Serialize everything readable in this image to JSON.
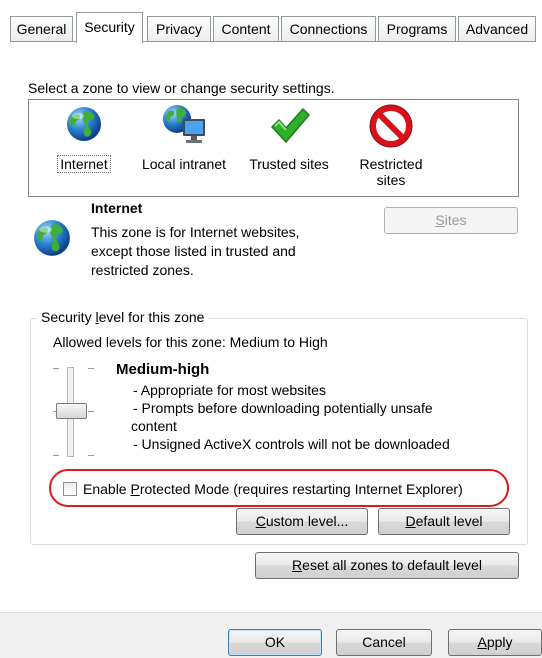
{
  "tabs": [
    {
      "label": "General",
      "active": false
    },
    {
      "label": "Security",
      "active": true
    },
    {
      "label": "Privacy",
      "active": false
    },
    {
      "label": "Content",
      "active": false
    },
    {
      "label": "Connections",
      "active": false
    },
    {
      "label": "Programs",
      "active": false
    },
    {
      "label": "Advanced",
      "active": false
    }
  ],
  "zone_prompt": "Select a zone to view or change security settings.",
  "zones": [
    {
      "label": "Internet",
      "icon": "globe-icon",
      "selected": true
    },
    {
      "label": "Local intranet",
      "icon": "intranet-icon",
      "selected": false
    },
    {
      "label": "Trusted sites",
      "icon": "checkmark-icon",
      "selected": false
    },
    {
      "label": "Restricted sites",
      "label_line1": "Restricted",
      "label_line2": "sites",
      "icon": "no-entry-icon",
      "selected": false
    }
  ],
  "zone_info": {
    "title": "Internet",
    "line1": "This zone is for Internet websites,",
    "line2": "except those listed in trusted and",
    "line3": "restricted zones.",
    "sites_button": {
      "accel": "S",
      "rest": "ites",
      "enabled": false
    }
  },
  "security_level": {
    "legend_pre": "Security ",
    "legend_accel": "l",
    "legend_post": "evel for this zone",
    "allowed": "Allowed levels for this zone: Medium to High",
    "level_name": "Medium-high",
    "bullets": [
      "- Appropriate for most websites",
      "- Prompts before downloading potentially unsafe",
      "content",
      "- Unsigned ActiveX controls will not be downloaded"
    ],
    "protected_mode": {
      "pre": "Enable ",
      "accel": "P",
      "post": "rotected Mode (requires restarting Internet Explorer)",
      "checked": false
    },
    "custom_button": {
      "accel": "C",
      "rest": "ustom level..."
    },
    "default_button": {
      "accel": "D",
      "rest": "efault level"
    }
  },
  "reset_button": {
    "accel": "R",
    "rest": "eset all zones to default level"
  },
  "footer": {
    "ok": "OK",
    "cancel": "Cancel",
    "apply_accel": "A",
    "apply_rest": "pply"
  },
  "colors": {
    "highlight_oval": "#e01a1a",
    "default_button_border": "#3c7fb1",
    "check_green": "#2fae29",
    "no_entry_red": "#d9111b"
  }
}
